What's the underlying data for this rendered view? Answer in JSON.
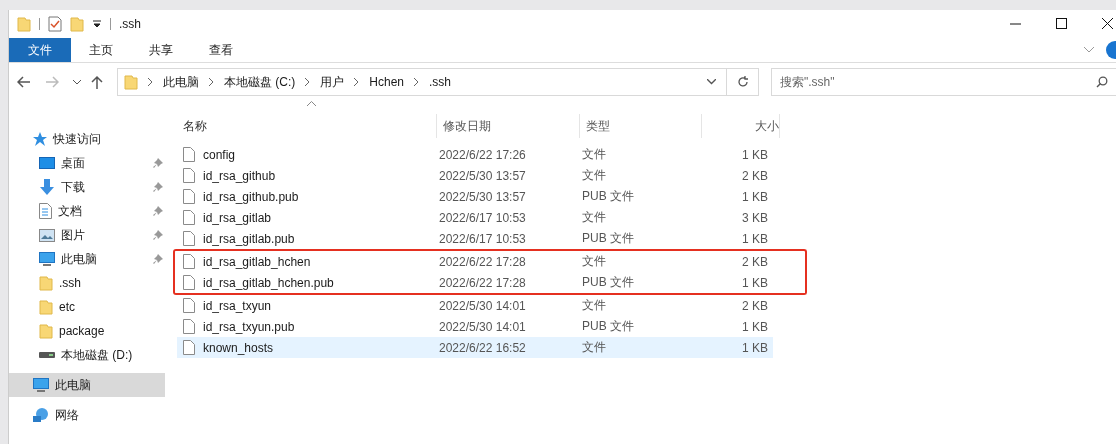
{
  "window": {
    "title": ".ssh"
  },
  "ribbon_tabs": [
    {
      "label": "文件",
      "selected": true
    },
    {
      "label": "主页",
      "selected": false
    },
    {
      "label": "共享",
      "selected": false
    },
    {
      "label": "查看",
      "selected": false
    }
  ],
  "address": {
    "crumbs": [
      "此电脑",
      "本地磁盘 (C:)",
      "用户",
      "Hchen",
      ".ssh"
    ]
  },
  "search": {
    "placeholder": "搜索\".ssh\""
  },
  "sidebar": {
    "items": [
      {
        "label": "快速访问",
        "kind": "star",
        "selected": false,
        "children": [
          {
            "label": "桌面",
            "kind": "desktop",
            "pinned": true,
            "selected": false
          },
          {
            "label": "下载",
            "kind": "download",
            "pinned": true,
            "selected": false
          },
          {
            "label": "文档",
            "kind": "document",
            "pinned": true,
            "selected": false
          },
          {
            "label": "图片",
            "kind": "picture",
            "pinned": true,
            "selected": false
          },
          {
            "label": "此电脑",
            "kind": "pc",
            "pinned": true,
            "selected": false
          },
          {
            "label": ".ssh",
            "kind": "folder",
            "pinned": false,
            "selected": false
          },
          {
            "label": "etc",
            "kind": "folder",
            "pinned": false,
            "selected": false
          },
          {
            "label": "package",
            "kind": "folder",
            "pinned": false,
            "selected": false
          },
          {
            "label": "本地磁盘 (D:)",
            "kind": "drive",
            "pinned": false,
            "selected": false
          }
        ]
      },
      {
        "label": "此电脑",
        "kind": "pc",
        "selected": true
      },
      {
        "label": "网络",
        "kind": "network",
        "selected": false
      }
    ]
  },
  "table": {
    "columns": [
      "名称",
      "修改日期",
      "类型",
      "大小"
    ],
    "rows": [
      {
        "name": "config",
        "date": "2022/6/22 17:26",
        "type": "文件",
        "size": "1 KB",
        "selected": false,
        "marked": false
      },
      {
        "name": "id_rsa_github",
        "date": "2022/5/30 13:57",
        "type": "文件",
        "size": "2 KB",
        "selected": false,
        "marked": false
      },
      {
        "name": "id_rsa_github.pub",
        "date": "2022/5/30 13:57",
        "type": "PUB 文件",
        "size": "1 KB",
        "selected": false,
        "marked": false
      },
      {
        "name": "id_rsa_gitlab",
        "date": "2022/6/17 10:53",
        "type": "文件",
        "size": "3 KB",
        "selected": false,
        "marked": false
      },
      {
        "name": "id_rsa_gitlab.pub",
        "date": "2022/6/17 10:53",
        "type": "PUB 文件",
        "size": "1 KB",
        "selected": false,
        "marked": false
      },
      {
        "name": "id_rsa_gitlab_hchen",
        "date": "2022/6/22 17:28",
        "type": "文件",
        "size": "2 KB",
        "selected": false,
        "marked": true
      },
      {
        "name": "id_rsa_gitlab_hchen.pub",
        "date": "2022/6/22 17:28",
        "type": "PUB 文件",
        "size": "1 KB",
        "selected": false,
        "marked": true
      },
      {
        "name": "id_rsa_txyun",
        "date": "2022/5/30 14:01",
        "type": "文件",
        "size": "2 KB",
        "selected": false,
        "marked": false
      },
      {
        "name": "id_rsa_txyun.pub",
        "date": "2022/5/30 14:01",
        "type": "PUB 文件",
        "size": "1 KB",
        "selected": false,
        "marked": false
      },
      {
        "name": "known_hosts",
        "date": "2022/6/22 16:52",
        "type": "文件",
        "size": "1 KB",
        "selected": true,
        "marked": false
      }
    ]
  }
}
